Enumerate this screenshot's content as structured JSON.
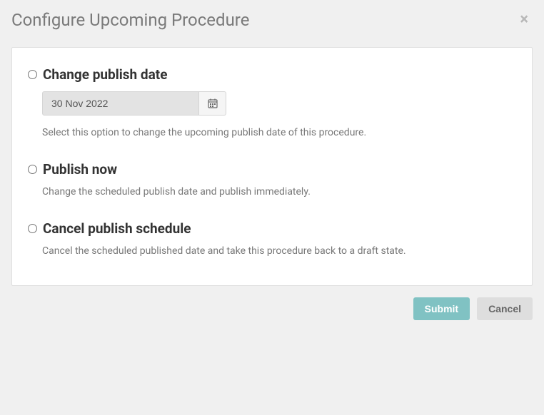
{
  "header": {
    "title": "Configure Upcoming Procedure",
    "close_label": "×"
  },
  "options": {
    "change_date": {
      "title": "Change publish date",
      "date_value": "30 Nov 2022",
      "help": "Select this option to change the upcoming publish date of this procedure."
    },
    "publish_now": {
      "title": "Publish now",
      "help": "Change the scheduled publish date and publish immediately."
    },
    "cancel_schedule": {
      "title": "Cancel publish schedule",
      "help": "Cancel the scheduled published date and take this procedure back to a draft state."
    }
  },
  "footer": {
    "submit_label": "Submit",
    "cancel_label": "Cancel"
  }
}
